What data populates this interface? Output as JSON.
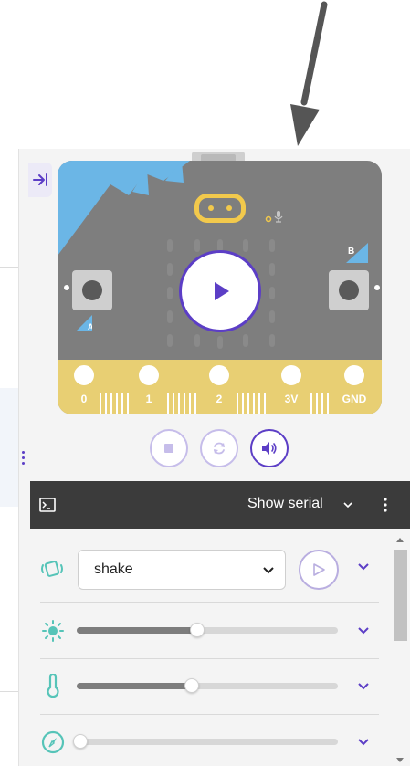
{
  "colors": {
    "accent": "#5c3ec6",
    "board": "#7e7e7e",
    "edge": "#e8cf73",
    "serialBar": "#3b3b3b",
    "sensorIcon": "#56c4b8"
  },
  "simulator": {
    "buttons": {
      "a": "A",
      "b": "B"
    },
    "pins": [
      "0",
      "1",
      "2",
      "3V",
      "GND"
    ]
  },
  "controls": [
    {
      "name": "stop",
      "icon": "stop-icon"
    },
    {
      "name": "restart",
      "icon": "restart-icon"
    },
    {
      "name": "mute",
      "icon": "speaker-icon"
    }
  ],
  "serial": {
    "label": "Show serial"
  },
  "sensors": {
    "gesture": {
      "selected": "shake"
    },
    "light": {
      "level": 0.46
    },
    "temperature": {
      "level": 0.44
    },
    "compass": {
      "level": 0.0
    }
  }
}
